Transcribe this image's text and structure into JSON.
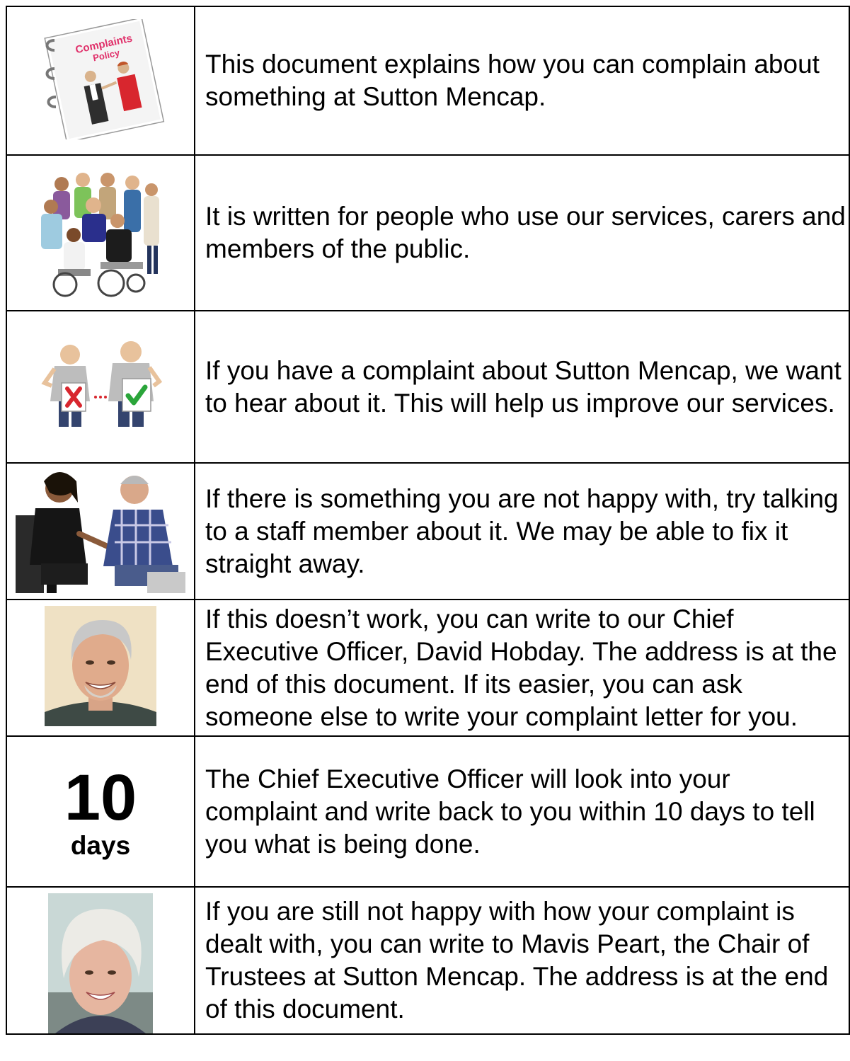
{
  "rows": [
    {
      "picture": "complaints-policy-book",
      "picture_text": "Complaints Policy",
      "text": "This document explains how you can complain about something at Sutton Mencap."
    },
    {
      "picture": "group-of-people",
      "text": "It is written for people who use our services, carers and members of the public."
    },
    {
      "picture": "wrong-and-right-signs",
      "text": "If you have a complaint about Sutton Mencap, we want to hear about it. This will help us improve our services."
    },
    {
      "picture": "two-people-talking",
      "text": "If there is something you are not happy with, try talking to a staff member about it. We may be able to fix it straight away."
    },
    {
      "picture": "photo-david-hobday",
      "text": "If this doesn’t work, you can write to our Chief Executive Officer, David Hobday. The address is at the end of this document. If its easier, you can ask someone else to write your complaint letter for you."
    },
    {
      "picture": "ten-days-label",
      "number": "10",
      "unit": "days",
      "text": "The Chief Executive Officer will look into your complaint and write back to you within 10 days to tell you what is being done."
    },
    {
      "picture": "photo-mavis-peart",
      "text": "If you are still not happy with how your complaint is dealt with, you can write to Mavis Peart, the Chair of Trustees at Sutton Mencap. The address is at the end of this document."
    }
  ]
}
